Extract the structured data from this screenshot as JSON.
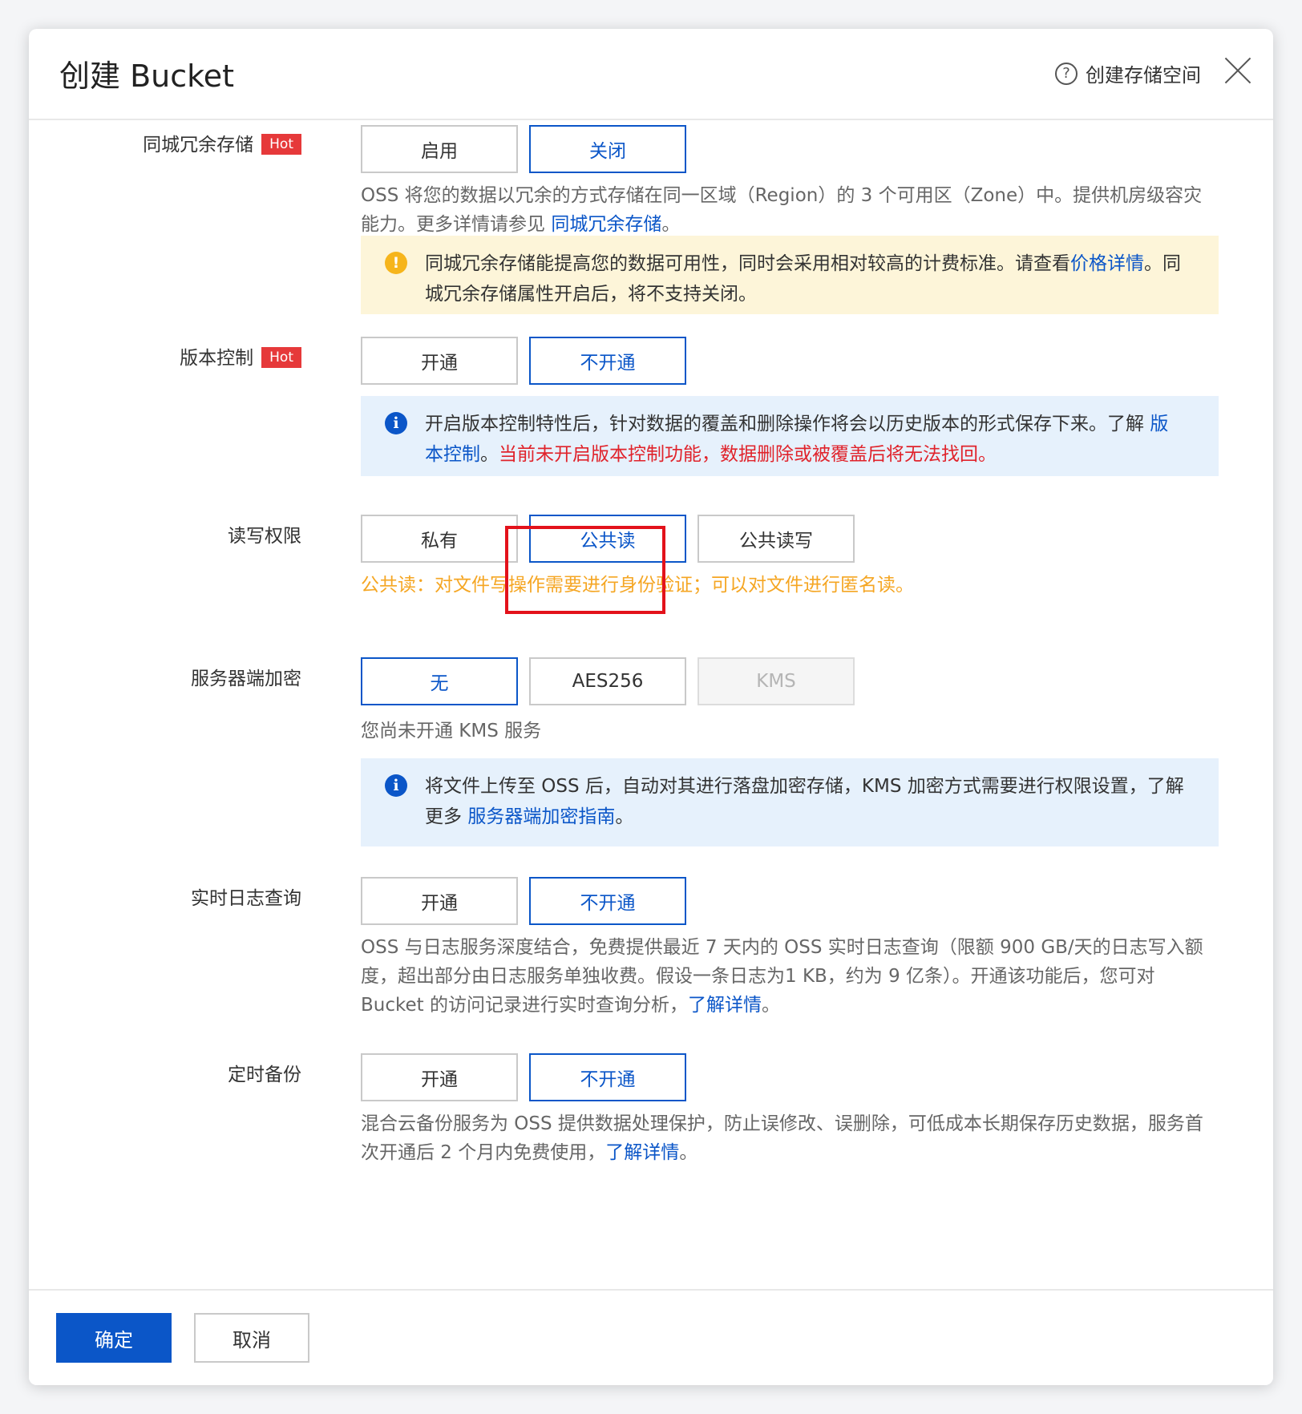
{
  "dialog": {
    "title": "创建 Bucket",
    "help_label": "创建存储空间",
    "help_icon": "question-circle-icon",
    "close_icon": "close-icon"
  },
  "redundancy": {
    "label": "同城冗余存储",
    "badge": "Hot",
    "options": [
      "启用",
      "关闭"
    ],
    "selected": "关闭",
    "desc_text": "OSS 将您的数据以冗余的方式存储在同一区域（Region）的 3 个可用区（Zone）中。提供机房级容灾能力。更多详情请参见 ",
    "desc_link": "同城冗余存储",
    "desc_end": "。",
    "alert_text1": "同城冗余存储能提高您的数据可用性，同时会采用相对较高的计费标准。请查看",
    "alert_link": "价格详情",
    "alert_text2": "。同城冗余存储属性开启后，将不支持关闭。"
  },
  "versioning": {
    "label": "版本控制",
    "badge": "Hot",
    "options": [
      "开通",
      "不开通"
    ],
    "selected": "不开通",
    "alert_text1": "开启版本控制特性后，针对数据的覆盖和删除操作将会以历史版本的形式保存下来。了解 ",
    "alert_link": "版本控制",
    "alert_text2": "。",
    "alert_warning": "当前未开启版本控制功能，数据删除或被覆盖后将无法找回。"
  },
  "acl": {
    "label": "读写权限",
    "options": [
      "私有",
      "公共读",
      "公共读写"
    ],
    "selected": "公共读",
    "note": "公共读：对文件写操作需要进行身份验证；可以对文件进行匿名读。"
  },
  "encryption": {
    "label": "服务器端加密",
    "options": [
      "无",
      "AES256",
      "KMS"
    ],
    "selected": "无",
    "disabled": "KMS",
    "kms_note": "您尚未开通 KMS 服务",
    "alert_text1": "将文件上传至 OSS 后，自动对其进行落盘加密存储，KMS 加密方式需要进行权限设置，了解更多 ",
    "alert_link": "服务器端加密指南",
    "alert_text2": "。"
  },
  "realtime_log": {
    "label": "实时日志查询",
    "options": [
      "开通",
      "不开通"
    ],
    "selected": "不开通",
    "desc_text": "OSS 与日志服务深度结合，免费提供最近 7 天内的 OSS 实时日志查询（限额 900 GB/天的日志写入额度，超出部分由日志服务单独收费。假设一条日志为1 KB，约为 9 亿条）。开通该功能后，您可对 Bucket 的访问记录进行实时查询分析，",
    "desc_link": "了解详情",
    "desc_end": "。"
  },
  "backup": {
    "label": "定时备份",
    "options": [
      "开通",
      "不开通"
    ],
    "selected": "不开通",
    "desc_text": "混合云备份服务为 OSS 提供数据处理保护，防止误修改、误删除，可低成本长期保存历史数据，服务首次开通后 2 个月内免费使用，",
    "desc_link": "了解详情",
    "desc_end": "。"
  },
  "footer": {
    "ok_label": "确定",
    "cancel_label": "取消"
  },
  "colors": {
    "primary": "#0b56c8",
    "hot": "#e6393a",
    "warn_bg": "#fdf5d9",
    "info_bg": "#e6f1fc",
    "highlight": "#e3121b",
    "note_orange": "#f5a623"
  }
}
